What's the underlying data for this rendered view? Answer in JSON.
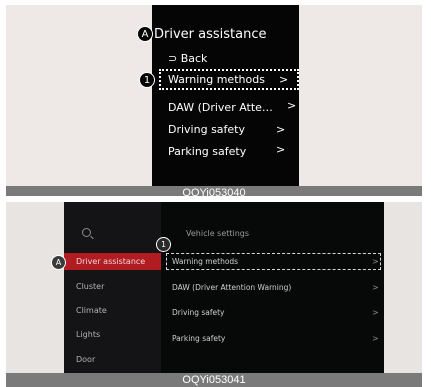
{
  "panel1": {
    "marker_a": "A",
    "title": "Driver assistance",
    "back_label": "⊃ Back",
    "items": [
      {
        "label": "Warning methods",
        "chevron": ">"
      },
      {
        "label": "DAW (Driver Atte…",
        "chevron": ">"
      },
      {
        "label": "Driving safety",
        "chevron": ">"
      },
      {
        "label": "Parking safety",
        "chevron": ">"
      }
    ],
    "marker_1": "1",
    "caption": "OQYi053040"
  },
  "panel2": {
    "marker_a": "A",
    "marker_1": "1",
    "title": "Vehicle settings",
    "sidebar": [
      "Driver assistance",
      "Cluster",
      "Climate",
      "Lights",
      "Door"
    ],
    "items": [
      {
        "label": "Warning methods",
        "chevron": ">"
      },
      {
        "label": "DAW (Driver Attention Warning)",
        "chevron": ">"
      },
      {
        "label": "Driving safety",
        "chevron": ">"
      },
      {
        "label": "Parking safety",
        "chevron": ">"
      }
    ],
    "caption": "OQYi053041"
  },
  "colors": {
    "accent_red": "#b01c22",
    "screen_bg": "#050505",
    "page_bg": "#eee9e6",
    "caption_bg": "#7a7a7a"
  }
}
